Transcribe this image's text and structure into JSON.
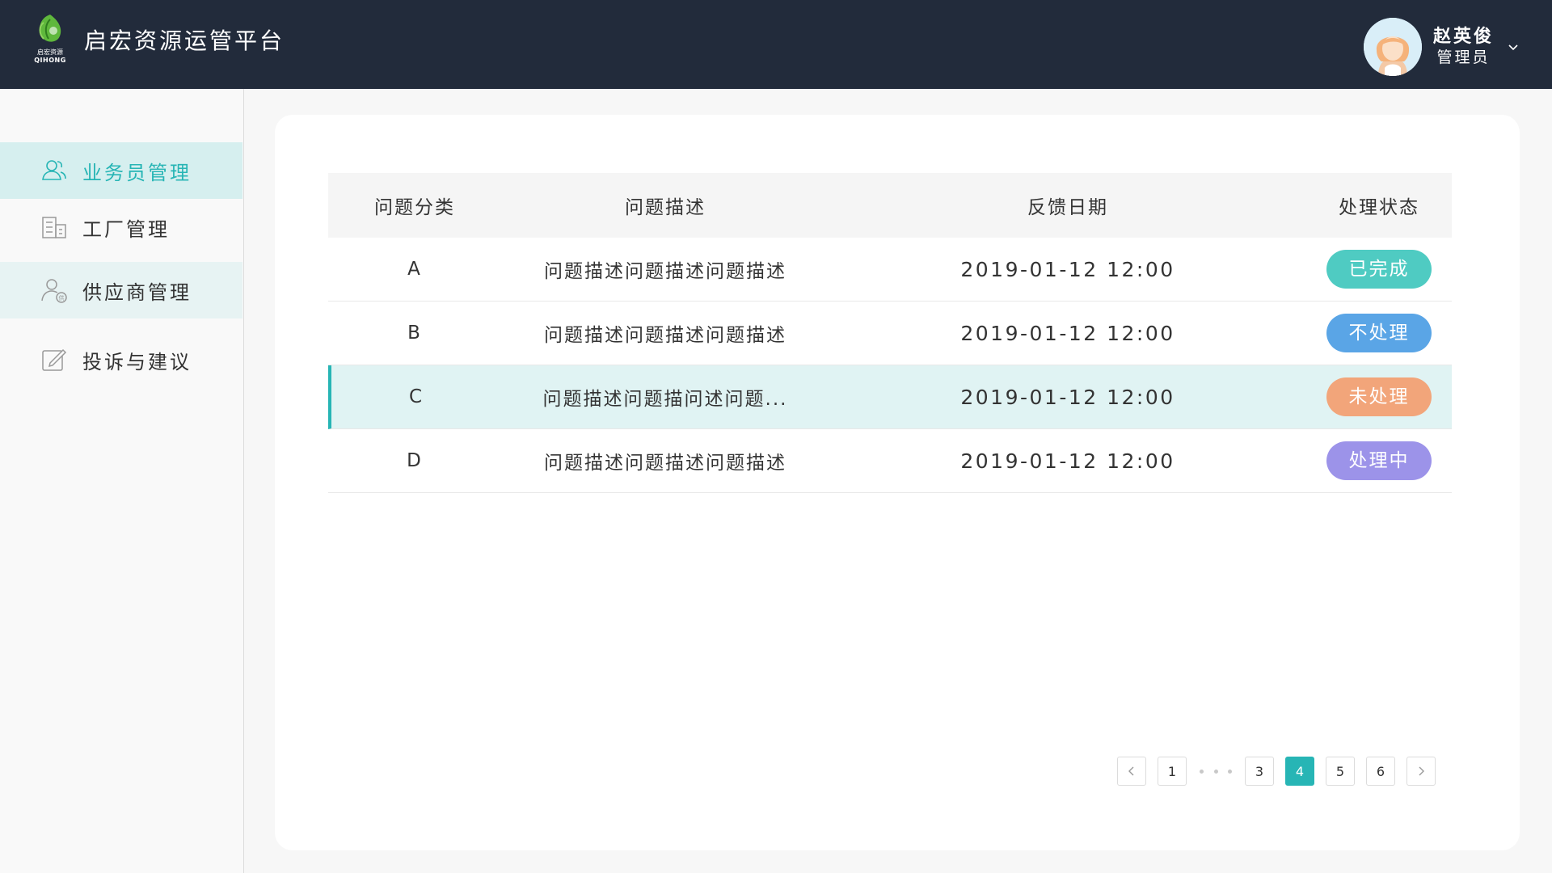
{
  "header": {
    "app_title": "启宏资源运管平台",
    "logo_cn": "启宏资源",
    "logo_en": "QIHONG",
    "user_name": "赵英俊",
    "user_role": "管理员"
  },
  "sidebar": {
    "items": [
      {
        "label": "业务员管理",
        "icon": "users-icon"
      },
      {
        "label": "工厂管理",
        "icon": "factory-icon"
      },
      {
        "label": "供应商管理",
        "icon": "supplier-icon"
      },
      {
        "label": "投诉与建议",
        "icon": "edit-icon"
      }
    ]
  },
  "table": {
    "headers": [
      "问题分类",
      "问题描述",
      "反馈日期",
      "处理状态"
    ],
    "rows": [
      {
        "category": "A",
        "description": "问题描述问题描述问题描述",
        "date": "2019-01-12 12:00",
        "status": "已完成"
      },
      {
        "category": "B",
        "description": "问题描述问题描述问题描述",
        "date": "2019-01-12 12:00",
        "status": "不处理"
      },
      {
        "category": "C",
        "description": "问题描述问题描问述问题...",
        "date": "2019-01-12 12:00",
        "status": "未处理"
      },
      {
        "category": "D",
        "description": "问题描述问题描述问题描述",
        "date": "2019-01-12 12:00",
        "status": "处理中"
      }
    ]
  },
  "status_colors": {
    "已完成": "#4fcbc2",
    "不处理": "#5aa5e6",
    "未处理": "#f2a57a",
    "处理中": "#9c93e9"
  },
  "pagination": {
    "pages": [
      "1",
      "3",
      "4",
      "5",
      "6"
    ],
    "current": "4"
  },
  "colors": {
    "accent": "#27b5b5",
    "header_bg": "#222b3b"
  }
}
